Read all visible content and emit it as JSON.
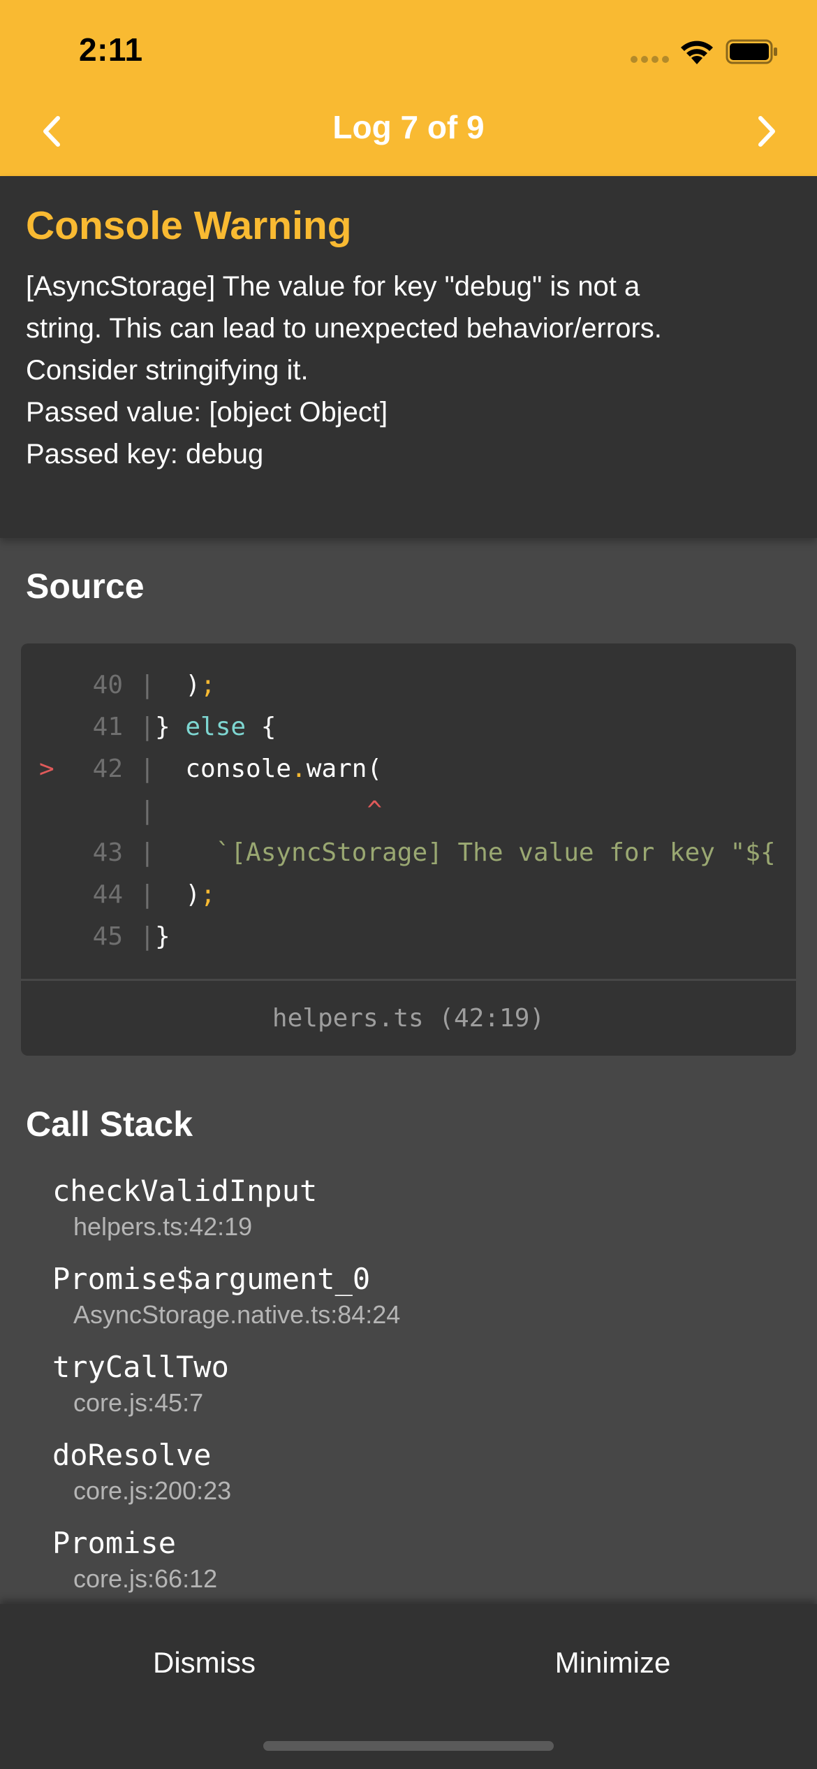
{
  "status_bar": {
    "time": "2:11"
  },
  "header": {
    "title": "Log 7 of 9",
    "background": "#F9BA32",
    "prev_icon": "chevron-left-icon",
    "next_icon": "chevron-right-icon"
  },
  "message": {
    "title": "Console Warning",
    "title_color": "#F9BA32",
    "lines": [
      "[AsyncStorage] The value for key \"debug\" is not a",
      "string. This can lead to unexpected behavior/errors.",
      "Consider stringifying it.",
      "Passed value: [object Object]",
      "Passed key: debug"
    ]
  },
  "source": {
    "heading": "Source",
    "lines": [
      {
        "num": "40",
        "code": "  );"
      },
      {
        "num": "41",
        "code": "} else {"
      },
      {
        "num": "42",
        "marker": ">",
        "code": "  console.warn("
      },
      {
        "num": "",
        "code": "              ^"
      },
      {
        "num": "43",
        "code": "    `[AsyncStorage] The value for key \"${ke"
      },
      {
        "num": "44",
        "code": "  );"
      },
      {
        "num": "45",
        "code": "}"
      }
    ],
    "file": "helpers.ts (42:19)"
  },
  "call_stack": {
    "heading": "Call Stack",
    "frames": [
      {
        "fn": "checkValidInput",
        "loc": "helpers.ts:42:19"
      },
      {
        "fn": "Promise$argument_0",
        "loc": "AsyncStorage.native.ts:84:24"
      },
      {
        "fn": "tryCallTwo",
        "loc": "core.js:45:7"
      },
      {
        "fn": "doResolve",
        "loc": "core.js:200:23"
      },
      {
        "fn": "Promise",
        "loc": "core.js:66:12"
      }
    ]
  },
  "footer": {
    "dismiss_label": "Dismiss",
    "minimize_label": "Minimize"
  }
}
